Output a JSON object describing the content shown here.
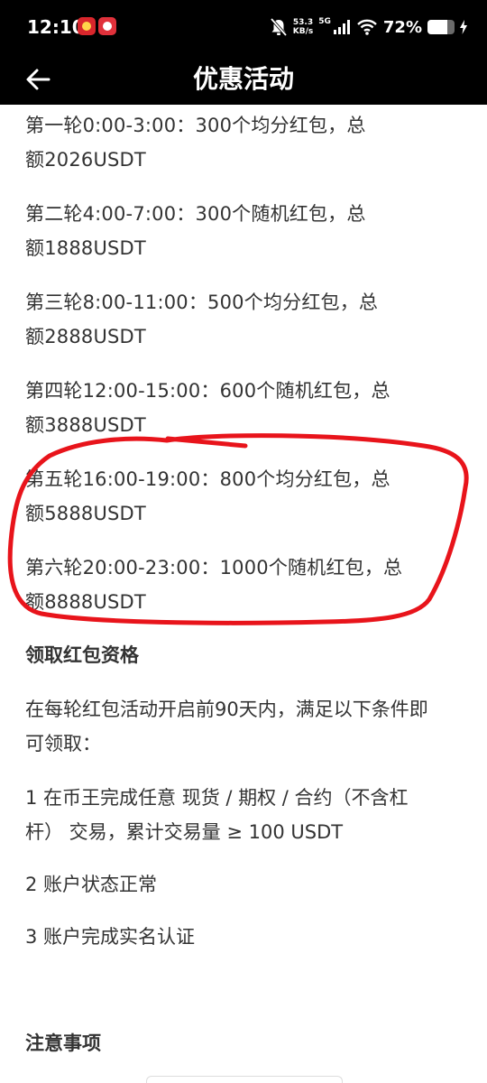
{
  "status_bar": {
    "time": "12:10",
    "net_speed_value": "53.3",
    "net_speed_unit": "KB/s",
    "network_gen": "5G",
    "battery_text": "72%",
    "battery_level": 0.72,
    "icons": [
      "app-badge-1",
      "app-badge-2",
      "mute-bell-icon",
      "signal-icon",
      "wifi-icon",
      "battery-icon",
      "charging-icon"
    ]
  },
  "header": {
    "title": "优惠活动",
    "back_icon": "arrow-left-icon"
  },
  "rounds": [
    {
      "line1": "第一轮0:00-3:00：300个均分红包，总",
      "line2": "额2026USDT"
    },
    {
      "line1": "第二轮4:00-7:00：300个随机红包，总",
      "line2": "额1888USDT"
    },
    {
      "line1": "第三轮8:00-11:00：500个均分红包，总",
      "line2": "额2888USDT"
    },
    {
      "line1": "第四轮12:00-15:00：600个随机红包，总",
      "line2": "额3888USDT"
    },
    {
      "line1": "第五轮16:00-19:00：800个均分红包，总",
      "line2": "额5888USDT"
    },
    {
      "line1": "第六轮20:00-23:00：1000个随机红包，总",
      "line2": "额8888USDT"
    }
  ],
  "eligibility": {
    "heading": "领取红包资格",
    "intro_line1": "在每轮红包活动开启前90天内，满足以下条件即",
    "intro_line2": "可领取：",
    "conditions": [
      {
        "line1": "1 在币王完成任意 现货 / 期权 / 合约（不含杠",
        "line2": "杆） 交易，累计交易量 ≥ 100 USDT"
      },
      {
        "line1": "2  账户状态正常"
      },
      {
        "line1": "3  账户完成实名认证"
      }
    ]
  },
  "notes": {
    "heading": "注意事项"
  },
  "colors": {
    "text": "#333333",
    "bar": "#000000",
    "annotation": "#e8141b"
  }
}
